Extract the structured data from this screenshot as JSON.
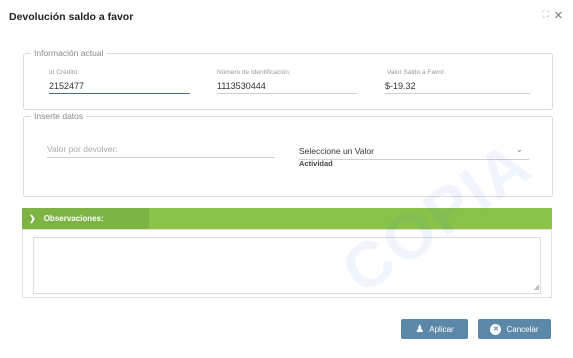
{
  "dialog": {
    "title": "Devolución saldo a favor"
  },
  "info": {
    "legend": "Información actual",
    "credit_id_label": "Id Crédito:",
    "credit_id_value": "2152477",
    "id_number_label": "Número de Identificación:",
    "id_number_value": "1113530444",
    "balance_label": "Valor Saldo a Favor:",
    "balance_value": "$-19.32"
  },
  "insert": {
    "legend": "Inserte datos",
    "amount_placeholder": "Valor por devolver:",
    "select_value": "Seleccione un Valor",
    "select_label": "Actividad"
  },
  "observations": {
    "header": "Observaciones:",
    "value": ""
  },
  "actions": {
    "apply_label": "Aplicar",
    "cancel_label": "Cancelar"
  },
  "colors": {
    "accent_green": "#8bc34a",
    "button_blue": "#5b87a8"
  },
  "icons": {
    "expand": "expand-icon",
    "close": "close-icon",
    "collapse": "chevron-down-icon",
    "apply": "user-icon",
    "cancel": "close-circle-icon"
  },
  "watermark": "COPIA"
}
